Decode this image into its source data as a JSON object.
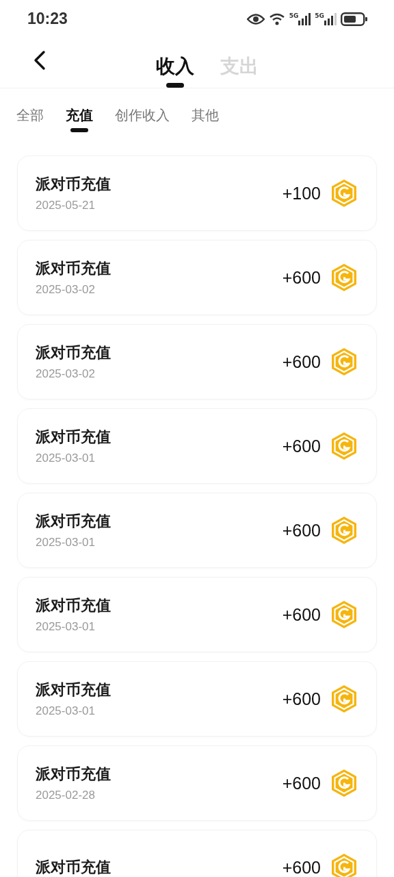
{
  "status_bar": {
    "time": "10:23",
    "network_1": "5G",
    "network_2": "5G"
  },
  "header": {
    "tabs": [
      {
        "label": "收入",
        "selected": true
      },
      {
        "label": "支出",
        "selected": false
      }
    ]
  },
  "filters": [
    {
      "label": "全部",
      "selected": false
    },
    {
      "label": "充值",
      "selected": true
    },
    {
      "label": "创作收入",
      "selected": false
    },
    {
      "label": "其他",
      "selected": false
    }
  ],
  "records": [
    {
      "title": "派对币充值",
      "date": "2025-05-21",
      "amount": "+100"
    },
    {
      "title": "派对币充值",
      "date": "2025-03-02",
      "amount": "+600"
    },
    {
      "title": "派对币充值",
      "date": "2025-03-02",
      "amount": "+600"
    },
    {
      "title": "派对币充值",
      "date": "2025-03-01",
      "amount": "+600"
    },
    {
      "title": "派对币充值",
      "date": "2025-03-01",
      "amount": "+600"
    },
    {
      "title": "派对币充值",
      "date": "2025-03-01",
      "amount": "+600"
    },
    {
      "title": "派对币充值",
      "date": "2025-03-01",
      "amount": "+600"
    },
    {
      "title": "派对币充值",
      "date": "2025-02-28",
      "amount": "+600"
    },
    {
      "title": "派对币充值",
      "amount": "+600"
    }
  ]
}
